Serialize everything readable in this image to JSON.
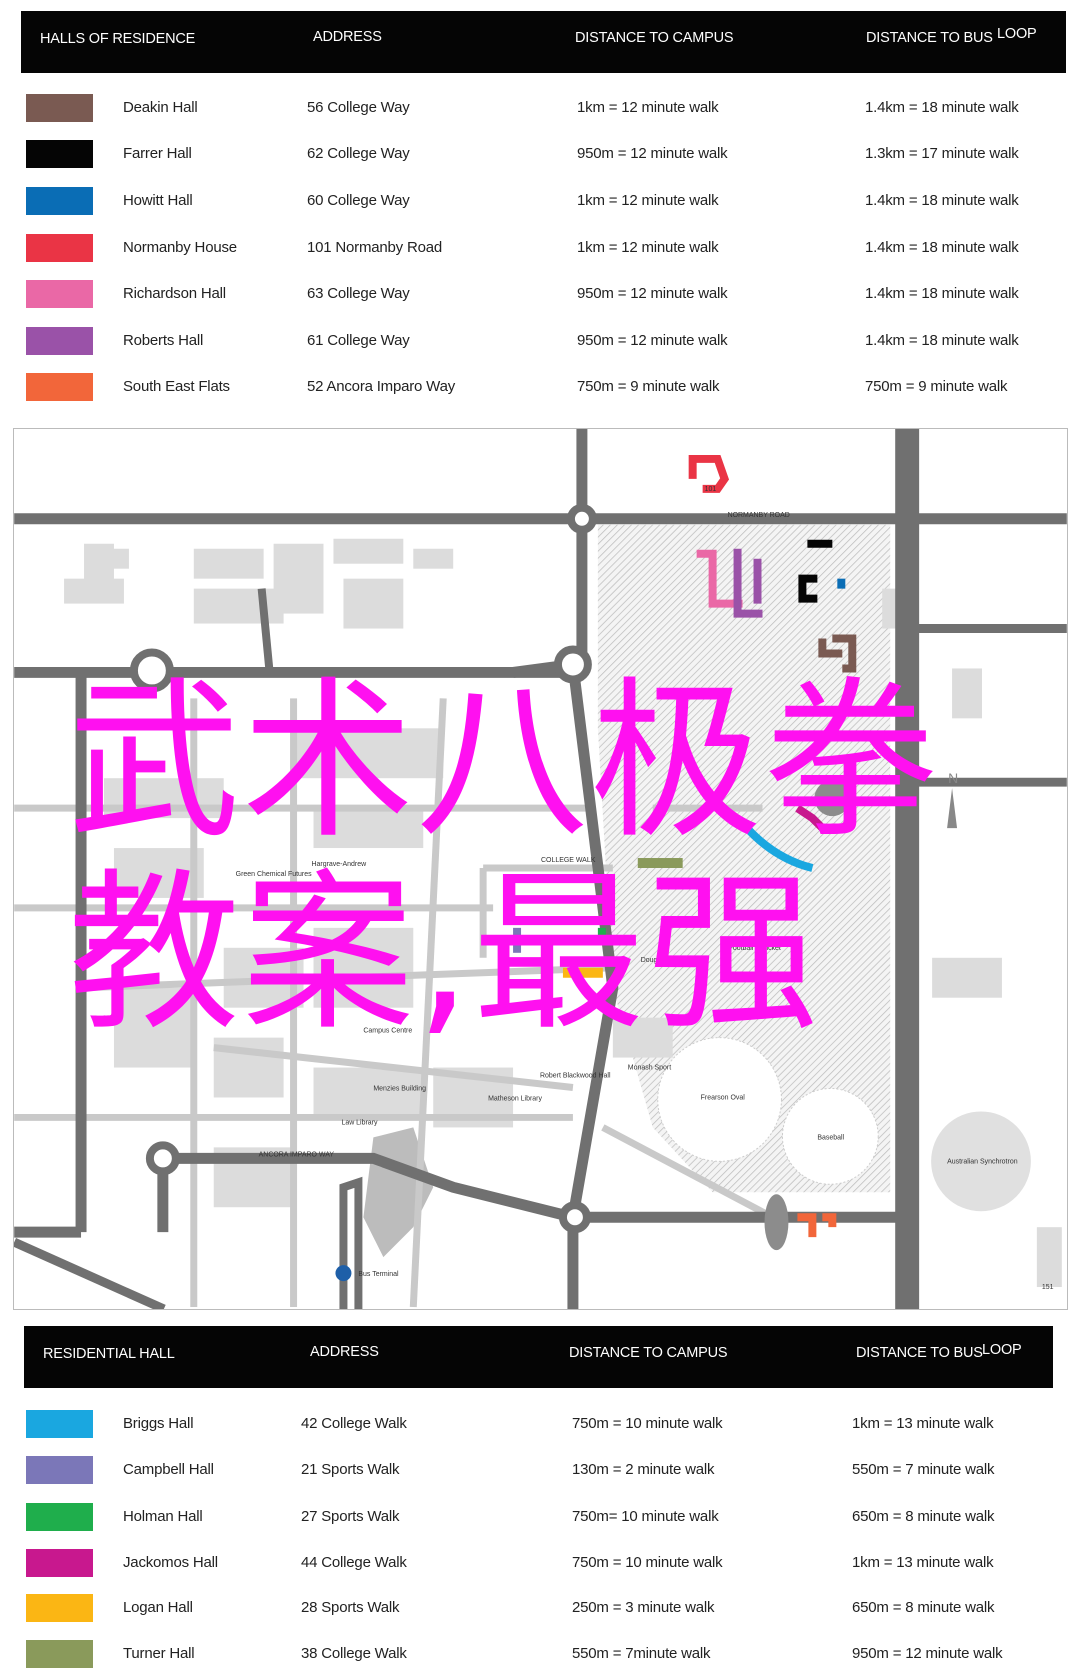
{
  "table1": {
    "headers": [
      "HALLS OF RESIDENCE",
      "ADDRESS",
      "DISTANCE TO CAMPUS",
      "DISTANCE TO BUS",
      "LOOP"
    ],
    "rows": [
      {
        "color": "#7a5a52",
        "name": "Deakin Hall",
        "address": "56 College Way",
        "campus": "1km = 12 minute walk",
        "bus": "1.4km = 18 minute walk"
      },
      {
        "color": "#050505",
        "name": "Farrer Hall",
        "address": "62 College Way",
        "campus": "950m = 12 minute walk",
        "bus": "1.3km = 17 minute walk"
      },
      {
        "color": "#0a6db5",
        "name": "Howitt Hall",
        "address": "60 College Way",
        "campus": "1km = 12 minute walk",
        "bus": "1.4km = 18 minute walk"
      },
      {
        "color": "#ea3445",
        "name": "Normanby House",
        "address": "101 Normanby Road",
        "campus": "1km = 12 minute walk",
        "bus": "1.4km = 18 minute walk"
      },
      {
        "color": "#ea68a6",
        "name": "Richardson Hall",
        "address": "63 College Way",
        "campus": "950m = 12 minute walk",
        "bus": "1.4km = 18 minute walk"
      },
      {
        "color": "#9a52a8",
        "name": "Roberts Hall",
        "address": "61 College Way",
        "campus": "950m = 12 minute walk",
        "bus": "1.4km = 18 minute walk"
      },
      {
        "color": "#f2663a",
        "name": "South East Flats",
        "address": "52 Ancora Imparo Way",
        "campus": "750m = 9 minute walk",
        "bus": "750m = 9 minute walk"
      }
    ]
  },
  "table2": {
    "headers": [
      "RESIDENTIAL HALL",
      "ADDRESS",
      "DISTANCE TO CAMPUS",
      "DISTANCE TO BUS",
      "LOOP"
    ],
    "rows": [
      {
        "color": "#1aa7e0",
        "name": "Briggs Hall",
        "address": "42 College Walk",
        "campus": "750m = 10 minute walk",
        "bus": "1km = 13 minute walk"
      },
      {
        "color": "#7b77b8",
        "name": "Campbell Hall",
        "address": "21 Sports Walk",
        "campus": "130m = 2 minute walk",
        "bus": "550m = 7 minute walk"
      },
      {
        "color": "#1fae4c",
        "name": "Holman Hall",
        "address": "27 Sports Walk",
        "campus": "750m= 10 minute walk",
        "bus": "650m = 8 minute walk"
      },
      {
        "color": "#c8188e",
        "name": "Jackomos Hall",
        "address": "44 College Walk",
        "campus": "750m = 10 minute walk",
        "bus": "1km = 13 minute walk"
      },
      {
        "color": "#fbb614",
        "name": "Logan Hall",
        "address": "28 Sports Walk",
        "campus": "250m = 3 minute walk",
        "bus": "650m = 8 minute walk"
      },
      {
        "color": "#8a9a5b",
        "name": "Turner Hall",
        "address": "38 College Walk",
        "campus": "550m = 7minute walk",
        "bus": "950m = 12 minute walk"
      }
    ]
  },
  "map": {
    "labels": [
      "NORMANBY ROAD",
      "101",
      "COLLEGE WALK",
      "Green Chemical Futures",
      "Hargrave-Andrew",
      "Campus Centre",
      "Menzies Building",
      "Law Library",
      "Matheson Library",
      "Robert Blackwood Hall",
      "Monash Sport",
      "Frearson Oval",
      "Baseball",
      "Australian Synchrotron",
      "ANCORA IMPARO WAY",
      "Bus Terminal",
      "Football / Cricket",
      "Doug Ellis",
      "151",
      "N"
    ]
  },
  "overlay": {
    "line1": "武术八极拳",
    "line2": "教案,最强",
    "color": "#ff10f0"
  }
}
